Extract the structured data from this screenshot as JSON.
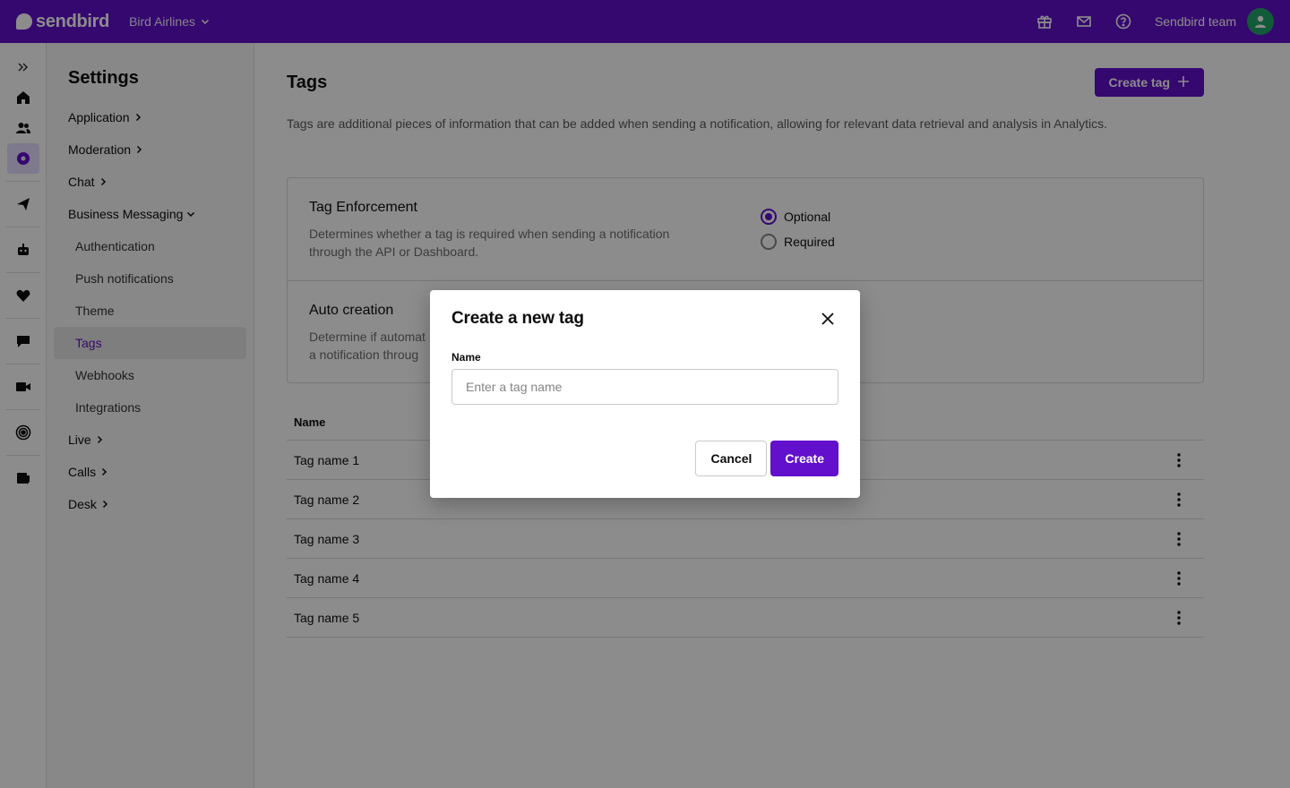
{
  "topbar": {
    "brand": "sendbird",
    "org": "Bird Airlines",
    "team": "Sendbird team",
    "icons": [
      "gift-icon",
      "mail-icon",
      "help-icon"
    ]
  },
  "rail": {
    "items": [
      "expand-icon",
      "home-icon",
      "users-icon",
      "settings-icon",
      "send-icon",
      "bot-icon",
      "heart-icon",
      "chat-icon",
      "video-icon",
      "broadcast-icon",
      "desk-icon"
    ]
  },
  "settings_nav": {
    "title": "Settings",
    "items": [
      {
        "label": "Application"
      },
      {
        "label": "Moderation"
      },
      {
        "label": "Chat"
      },
      {
        "label": "Business Messaging"
      },
      {
        "label": "Authentication"
      },
      {
        "label": "Push notifications"
      },
      {
        "label": "Theme"
      },
      {
        "label": "Tags"
      },
      {
        "label": "Webhooks"
      },
      {
        "label": "Integrations"
      },
      {
        "label": "Live"
      },
      {
        "label": "Calls"
      },
      {
        "label": "Desk"
      }
    ]
  },
  "page": {
    "title": "Tags",
    "create_button": "Create tag",
    "description": "Tags are additional pieces of information that can be added when sending a notification, allowing for relevant data retrieval and analysis in Analytics."
  },
  "enforcement": {
    "title": "Tag Enforcement",
    "desc_line1": "Determines whether a tag is required when sending a notification",
    "desc_line2": "through the API or Dashboard.",
    "options": [
      "Optional",
      "Required"
    ],
    "selected": "Optional"
  },
  "auto_creation": {
    "title": "Auto creation",
    "desc_line1": "Determine if automat",
    "desc_line2": "a notification throug"
  },
  "table": {
    "header": "Name",
    "rows": [
      "Tag name 1",
      "Tag name 2",
      "Tag name 3",
      "Tag name 4",
      "Tag name 5"
    ]
  },
  "modal": {
    "title": "Create a new tag",
    "field_label": "Name",
    "placeholder": "Enter a tag name",
    "value": "",
    "cancel": "Cancel",
    "create": "Create"
  },
  "colors": {
    "brand": "#6210cc",
    "avatar": "#22a46b"
  }
}
